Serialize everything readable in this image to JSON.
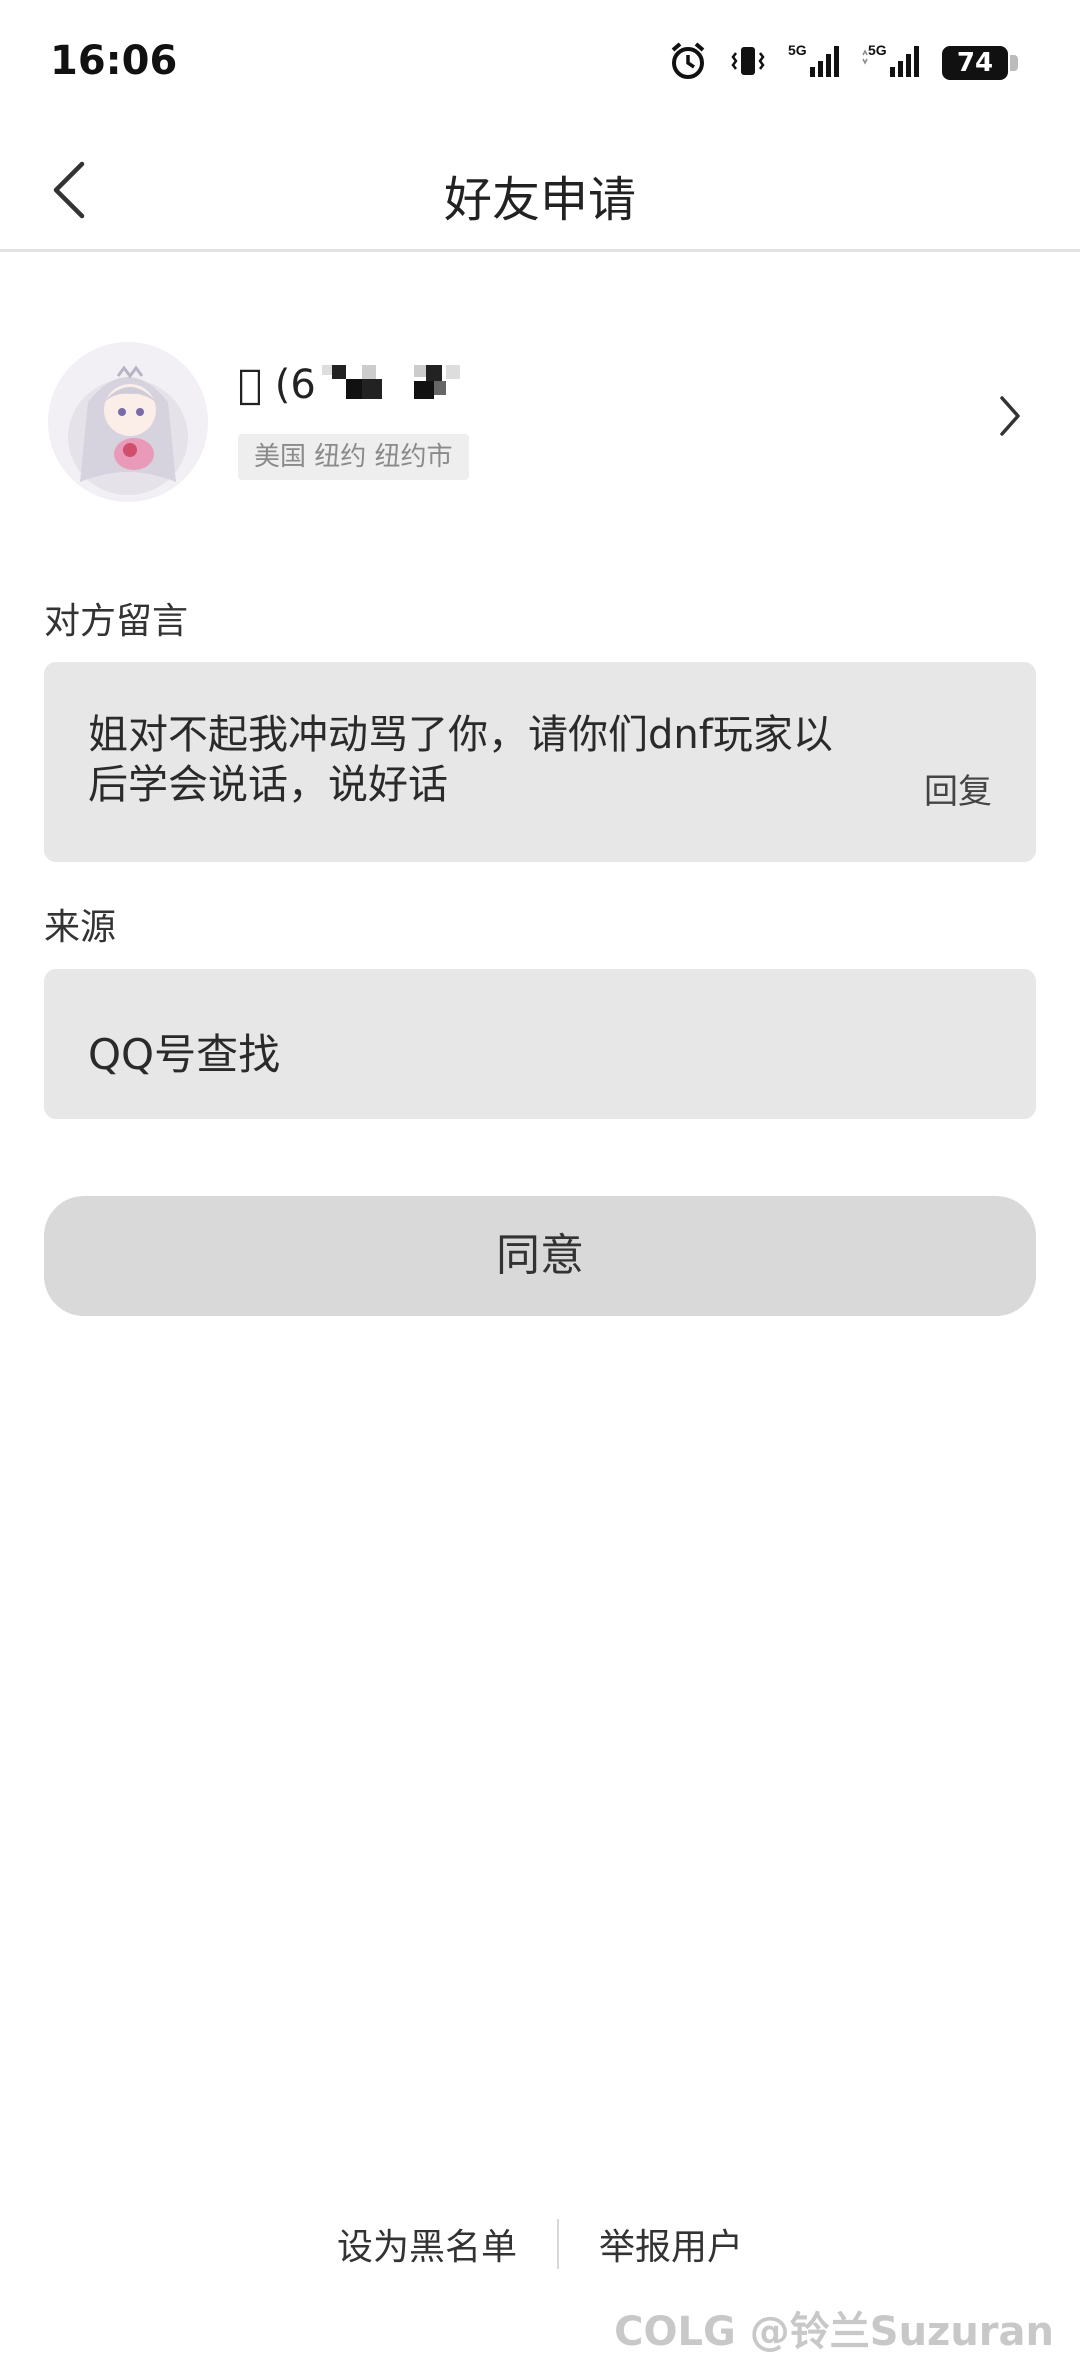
{
  "status_bar": {
    "time": "16:06",
    "signal1_label": "5G",
    "signal2_label": "5G",
    "battery": "74"
  },
  "nav": {
    "title": "好友申请"
  },
  "profile": {
    "nickname": "\u0000 (6",
    "location": "美国 纽约 纽约市"
  },
  "message": {
    "label": "对方留言",
    "text": "姐对不起我冲动骂了你，请你们dnf玩家以后学会说话，说好话",
    "reply_label": "回复"
  },
  "source": {
    "label": "来源",
    "value": "QQ号查找"
  },
  "agree_label": "同意",
  "footer": {
    "blacklist_label": "设为黑名单",
    "report_label": "举报用户"
  },
  "watermark": "COLG @铃兰Suzuran"
}
